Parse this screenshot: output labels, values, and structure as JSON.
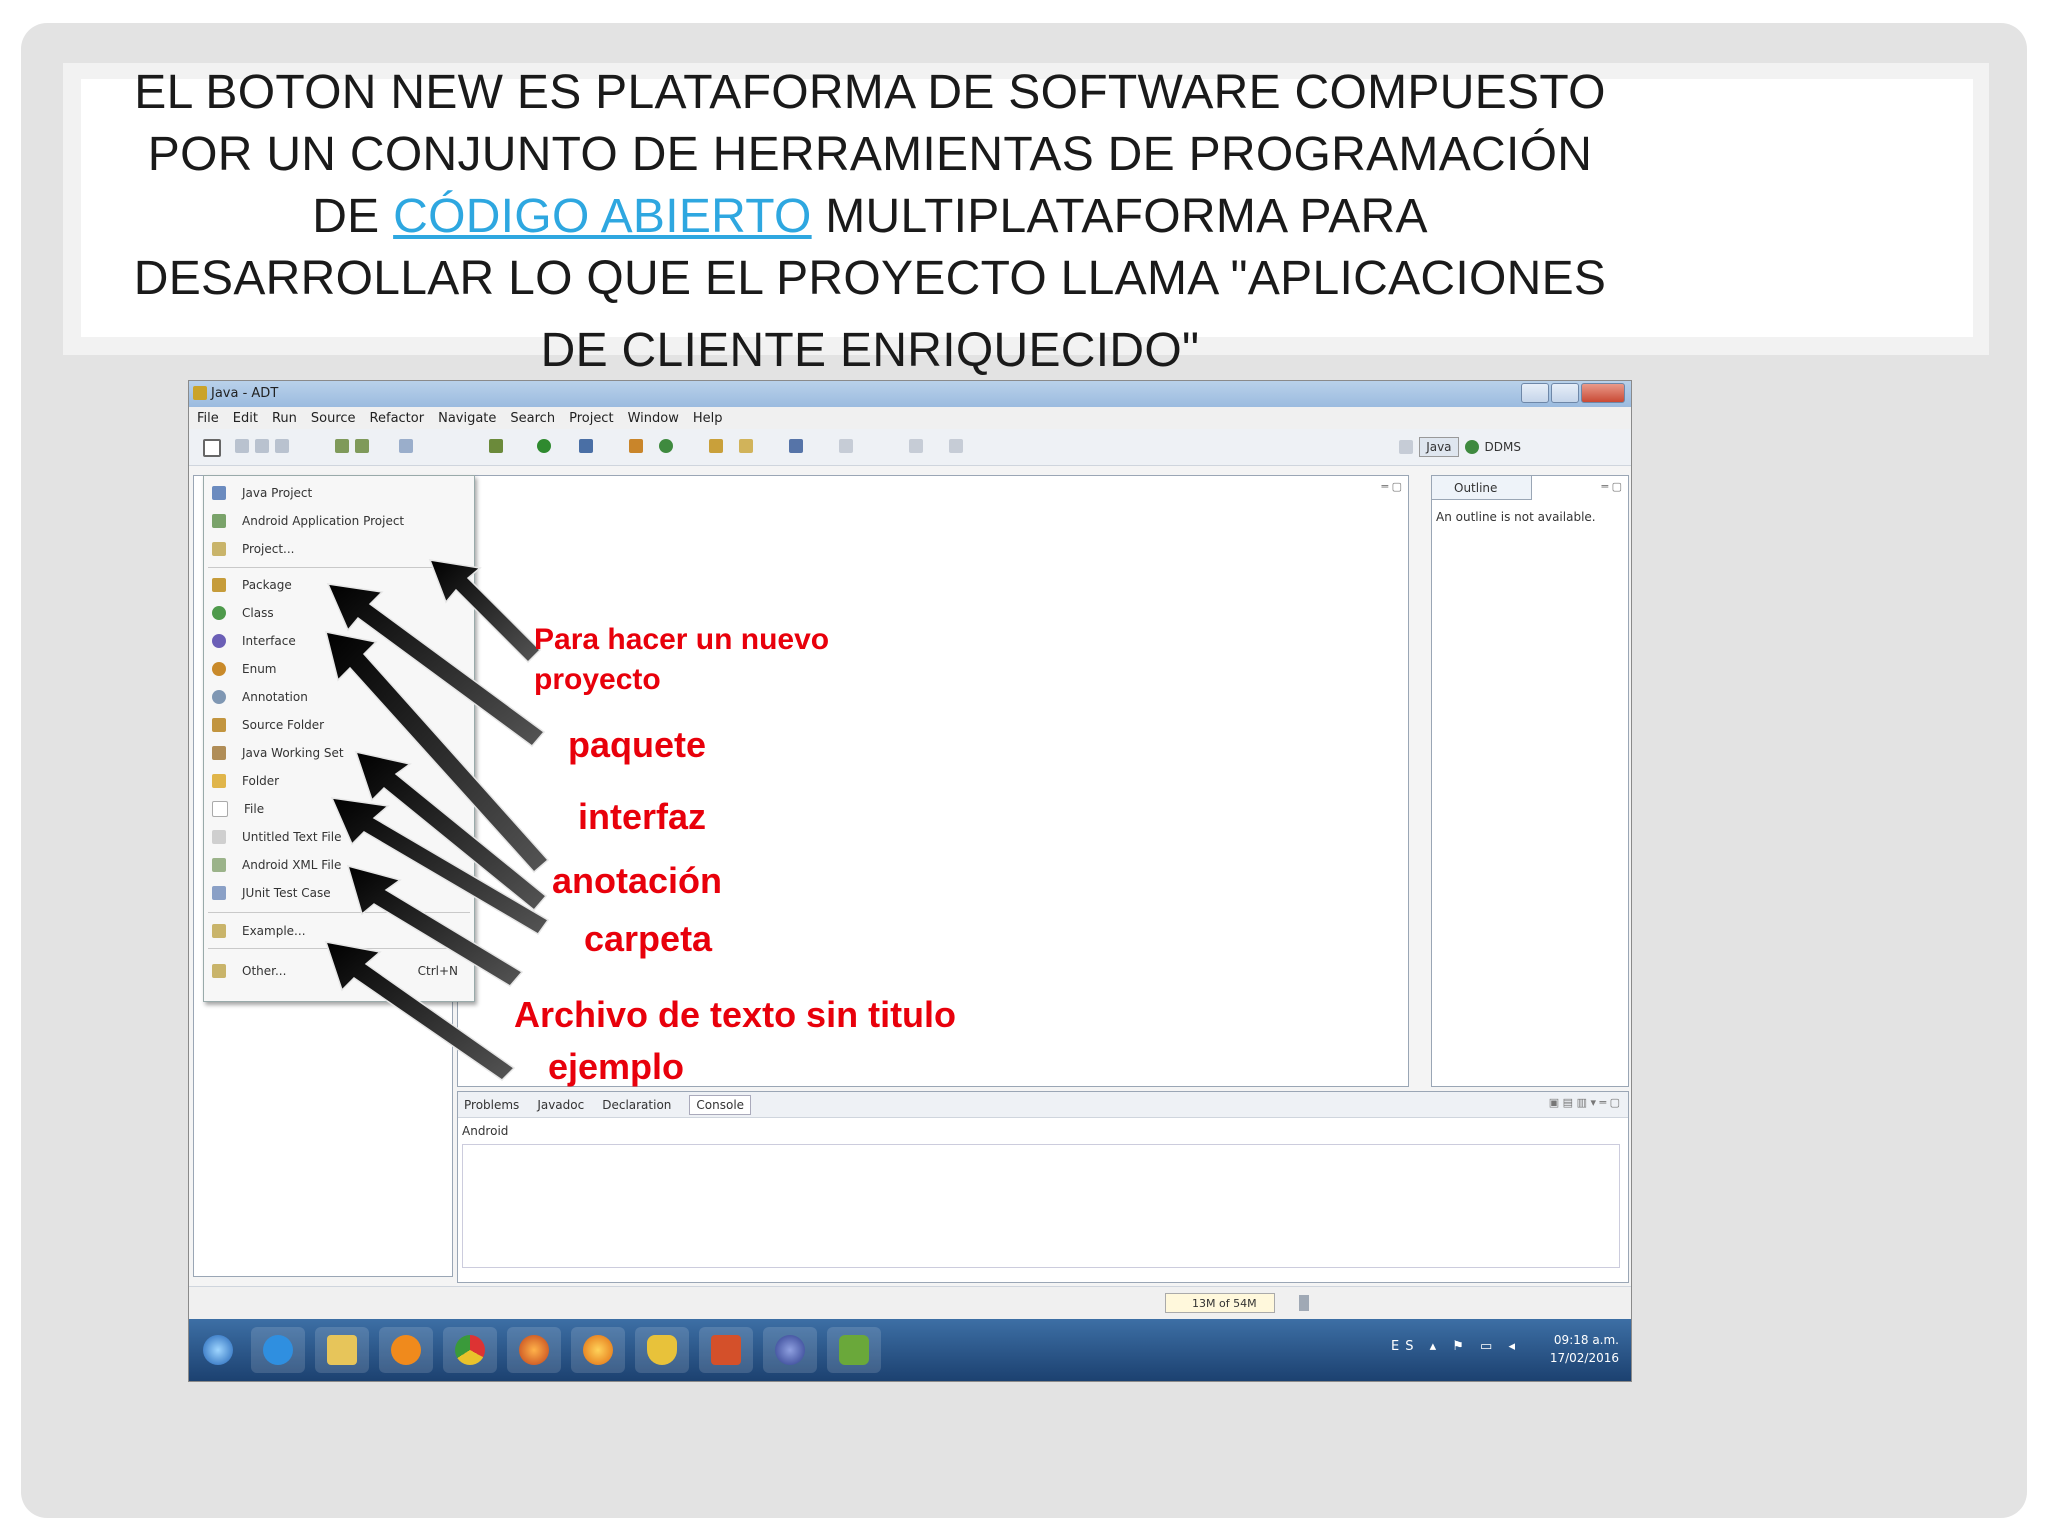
{
  "slide": {
    "title_line1": "EL BOTON NEW ES PLATAFORMA DE SOFTWARE COMPUESTO",
    "title_line2": "POR UN CONJUNTO DE HERRAMIENTAS DE PROGRAMACIÓN",
    "title_line3_pre": "DE ",
    "title_link": "CÓDIGO ABIERTO",
    "title_line3_post": " MULTIPLATAFORMA  PARA",
    "title_line4": "DESARROLLAR LO QUE EL PROYECTO LLAMA \"APLICACIONES",
    "title_line5": "DE CLIENTE ENRIQUECIDO\"",
    "link_color": "#2ea7e0"
  },
  "window": {
    "title": "Java - ADT",
    "menu": [
      "File",
      "Edit",
      "Run",
      "Source",
      "Refactor",
      "Navigate",
      "Search",
      "Project",
      "Window",
      "Help"
    ],
    "perspective_java": "Java",
    "perspective_ddms": "DDMS"
  },
  "new_menu": {
    "items": [
      {
        "label": "Java Project",
        "icon_color": "#6b8bbf"
      },
      {
        "label": "Android Application Project",
        "icon_color": "#7aa36a"
      },
      {
        "label": "Project...",
        "icon_color": "#c9b46a"
      },
      {
        "label": "Package",
        "icon_color": "#c69c3a"
      },
      {
        "label": "Class",
        "icon_color": "#4e9a4b"
      },
      {
        "label": "Interface",
        "icon_color": "#6b5fb6"
      },
      {
        "label": "Enum",
        "icon_color": "#c98a2a"
      },
      {
        "label": "Annotation",
        "icon_color": "#7f97b3"
      },
      {
        "label": "Source Folder",
        "icon_color": "#c2953f"
      },
      {
        "label": "Java Working Set",
        "icon_color": "#b08d57"
      },
      {
        "label": "Folder",
        "icon_color": "#e0b54a"
      },
      {
        "label": "File",
        "icon_color": "#d9d9d9"
      },
      {
        "label": "Untitled Text File",
        "icon_color": "#cfcfcf"
      },
      {
        "label": "Android XML File",
        "icon_color": "#9bb38a"
      },
      {
        "label": "JUnit Test Case",
        "icon_color": "#8aa0c6"
      },
      {
        "label": "Example...",
        "icon_color": "#c9b46a"
      },
      {
        "label": "Other...",
        "icon_color": "#c9b46a",
        "shortcut": "Ctrl+N"
      }
    ]
  },
  "outline": {
    "tab": "Outline",
    "message": "An outline is not available."
  },
  "console": {
    "tabs": [
      "Problems",
      "Javadoc",
      "Declaration",
      "Console"
    ],
    "active_tab": "Console",
    "sub": "Android"
  },
  "status": {
    "memory": "13M of 54M"
  },
  "taskbar": {
    "lang": "ES",
    "time": "09:18 a.m.",
    "date": "17/02/2016"
  },
  "annotations": {
    "nuevo_proyecto_1": "Para hacer un nuevo",
    "nuevo_proyecto_2": "proyecto",
    "paquete": "paquete",
    "interfaz": "interfaz",
    "anotacion": "anotación",
    "carpeta": "carpeta",
    "archivo": "Archivo de texto sin titulo",
    "ejemplo": "ejemplo",
    "color": "#e8000b"
  }
}
